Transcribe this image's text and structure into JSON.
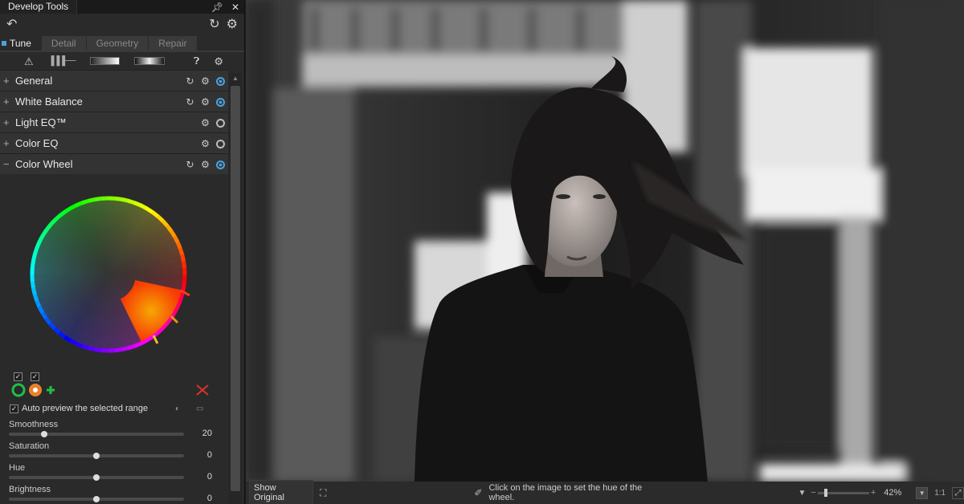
{
  "panel": {
    "title": "Develop Tools",
    "pin_icon": "pin-icon",
    "close_icon": "close-icon",
    "undo_icon": "undo-icon",
    "reset_all_icon": "reset-all-icon",
    "settings_icon": "settings-icon"
  },
  "tabs": [
    {
      "label": "Tune",
      "active": true
    },
    {
      "label": "Detail",
      "active": false
    },
    {
      "label": "Geometry",
      "active": false
    },
    {
      "label": "Repair",
      "active": false
    }
  ],
  "sections": [
    {
      "label": "General",
      "expanded": false,
      "has_reset": true,
      "enabled": true
    },
    {
      "label": "White Balance",
      "expanded": false,
      "has_reset": true,
      "enabled": true
    },
    {
      "label": "Light EQ™",
      "expanded": false,
      "has_reset": false,
      "enabled": false
    },
    {
      "label": "Color EQ",
      "expanded": false,
      "has_reset": false,
      "enabled": false
    },
    {
      "label": "Color Wheel",
      "expanded": true,
      "has_reset": true,
      "enabled": true
    }
  ],
  "color_wheel": {
    "auto_preview_label": "Auto preview the selected range",
    "auto_preview_checked": true,
    "sliders": [
      {
        "label": "Smoothness",
        "value": "20",
        "fraction": 0.2
      },
      {
        "label": "Saturation",
        "value": "0",
        "fraction": 0.5
      },
      {
        "label": "Hue",
        "value": "0",
        "fraction": 0.5
      },
      {
        "label": "Brightness",
        "value": "0",
        "fraction": 0.5
      }
    ]
  },
  "status_bar": {
    "show_original": "Show Original",
    "hint": "Click on the image to set the hue of the wheel.",
    "zoom": "42%",
    "one_to_one": "1:1"
  },
  "colors": {
    "accent": "#4aa3df",
    "panel_bg": "#2a2a2a",
    "delete_red": "#d9342b",
    "range_green": "#1fbf4a",
    "range_orange": "#e8812a"
  }
}
